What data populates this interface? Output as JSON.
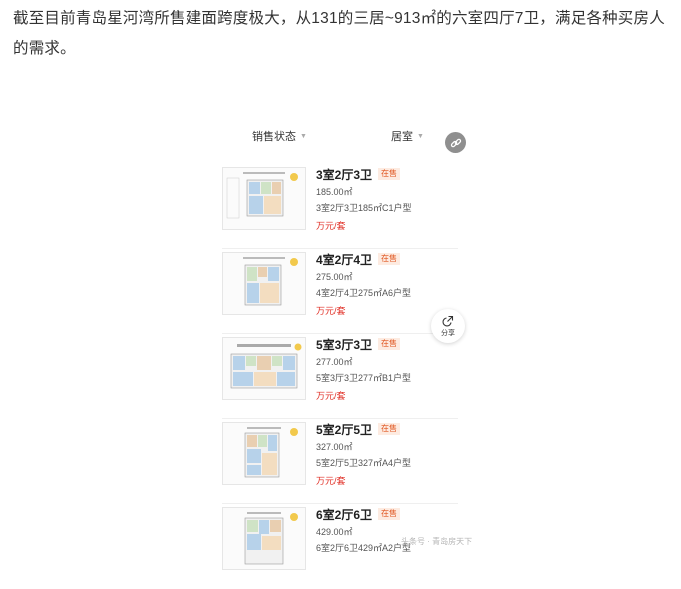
{
  "article": {
    "intro": "截至目前青岛星河湾所售建面跨度极大，从131的三居~913㎡的六室四厅7卫，满足各种买房人的需求。"
  },
  "filters": [
    {
      "label": "销售状态"
    },
    {
      "label": "居室"
    }
  ],
  "listings": [
    {
      "title": "3室2厅3卫",
      "status": "在售",
      "area": "185.00㎡",
      "desc": "3室2厅3卫185㎡C1户型",
      "price": "万元/套"
    },
    {
      "title": "4室2厅4卫",
      "status": "在售",
      "area": "275.00㎡",
      "desc": "4室2厅4卫275㎡A6户型",
      "price": "万元/套"
    },
    {
      "title": "5室3厅3卫",
      "status": "在售",
      "area": "277.00㎡",
      "desc": "5室3厅3卫277㎡B1户型",
      "price": "万元/套"
    },
    {
      "title": "5室2厅5卫",
      "status": "在售",
      "area": "327.00㎡",
      "desc": "5室2厅5卫327㎡A4户型",
      "price": "万元/套"
    },
    {
      "title": "6室2厅6卫",
      "status": "在售",
      "area": "429.00㎡",
      "desc": "6室2厅6卫429㎡A2户型",
      "price": ""
    }
  ],
  "share": {
    "label": "分享"
  },
  "watermark": {
    "text": "头条号 · 青岛房天下"
  },
  "icons": {
    "link": "link-icon",
    "share": "share-icon",
    "caret": "caret-down-icon"
  },
  "colors": {
    "badge_text": "#e0551f",
    "badge_bg": "#fdebe1",
    "price": "#e02e24"
  }
}
